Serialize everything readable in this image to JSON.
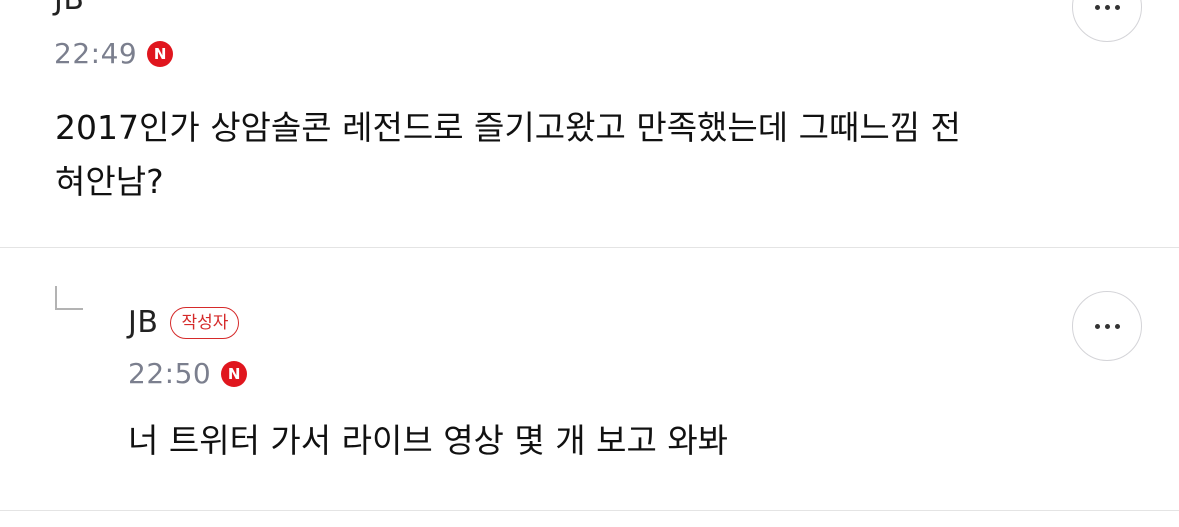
{
  "comments": [
    {
      "author": "JB",
      "time": "22:49",
      "new_badge": "N",
      "text": "2017인가 상암솔콘 레전드로 즐기고왔고 만족했는데 그때느낌 전\n혀안남?",
      "more_icon": "more-horizontal-icon"
    },
    {
      "author": "JB",
      "author_badge": "작성자",
      "time": "22:50",
      "new_badge": "N",
      "text": "너 트위터 가서 라이브 영상 몇 개 보고 와봐",
      "more_icon": "more-horizontal-icon",
      "reply_icon": "reply-arrow-icon"
    }
  ],
  "colors": {
    "new_badge": "#e0161e",
    "writer_badge": "#d52a2a",
    "time": "#7b7f8e",
    "divider": "#e4e4e4"
  }
}
